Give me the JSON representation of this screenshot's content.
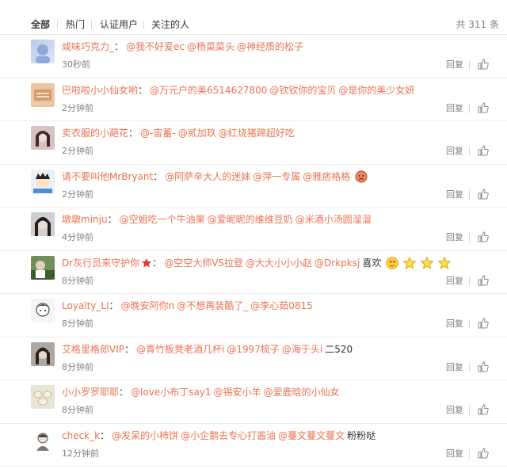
{
  "tabs": {
    "all": "全部",
    "hot": "热门",
    "verified": "认证用户",
    "followed": "关注的人",
    "total": "共 311 条"
  },
  "actions": {
    "reply": "回复"
  },
  "comments": [
    {
      "user": "咸味巧克力_",
      "mentions": [
        "@我不好爱ec",
        "@杨菜菜头",
        "@神经质的松子"
      ],
      "extra": "",
      "time": "30秒前"
    },
    {
      "user": "巴啦啦小小仙女哟",
      "mentions": [
        "@万元户的美6514627800",
        "@钦钦你的宝贝",
        "@是你的美少女妍"
      ],
      "extra": "",
      "time": "2分钟前"
    },
    {
      "user": "卖衣服的小葩花",
      "mentions": [
        "@-宙蓄-",
        "@贰加玖",
        "@红烧猪蹄超好吃"
      ],
      "extra": "",
      "time": "2分钟前"
    },
    {
      "user": "请不要叫他MrBryant",
      "mentions": [
        "@阿萨辛大人的迷妹",
        "@萍一专属",
        "@雅痞格格"
      ],
      "extra": "",
      "time": "2分钟前"
    },
    {
      "user": "墩墩minju",
      "mentions": [
        "@空姐吃一个牛油果",
        "@爱昵昵的维维豆奶",
        "@米酒小汤圆溜溜"
      ],
      "extra": "",
      "time": "4分钟前"
    },
    {
      "user": "Dr灰行员来守护你",
      "mentions": [
        "@空空大师VS拉登",
        "@大大小小小赵",
        "@Drkpksj"
      ],
      "extra": "喜欢",
      "time": "8分钟前"
    },
    {
      "user": "Loyalty_LI",
      "mentions": [
        "@晚安阿你n",
        "@不想再装酷了_",
        "@李心茹0815"
      ],
      "extra": "",
      "time": "8分钟前"
    },
    {
      "user": "艾格里格郎VIP",
      "mentions": [
        "@青竹板凳老酒几杯i",
        "@1997梳子",
        "@海于头i"
      ],
      "extra": "二520",
      "time": "8分钟前"
    },
    {
      "user": "小小罗罗耶耶",
      "mentions": [
        "@love小布丁say1",
        "@锡安小羊",
        "@爱鹿晗的小仙女"
      ],
      "extra": "",
      "time": "8分钟前"
    },
    {
      "user": "check_k",
      "mentions": [
        "@发呆的小柿饼",
        "@小企鹅去专心打酱油",
        "@蔓文蔓文蔓文"
      ],
      "extra": "粉粉哒",
      "time": "12分钟前"
    }
  ]
}
